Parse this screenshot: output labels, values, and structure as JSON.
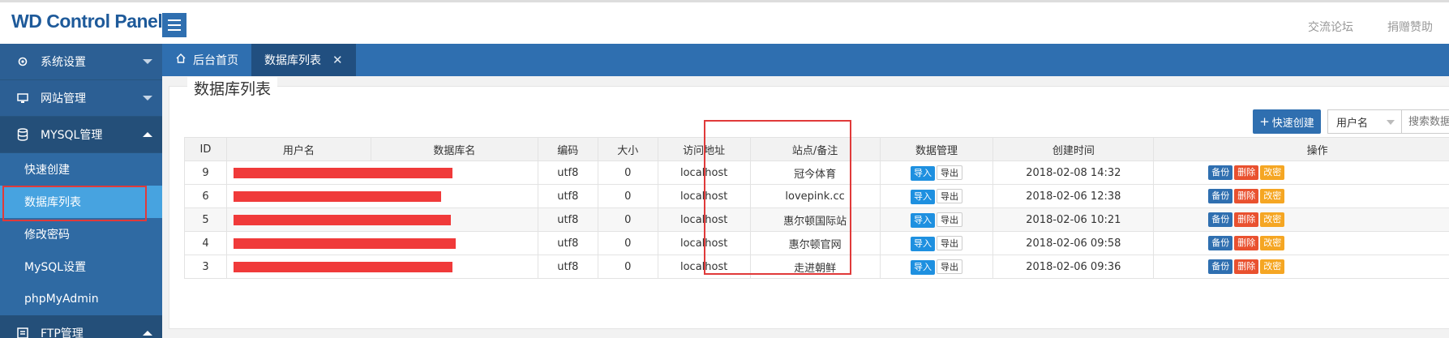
{
  "brand": "WD Control Panel",
  "top_links": [
    "交流论坛",
    "捐赠赞助"
  ],
  "sidebar": {
    "groups": [
      {
        "label": "系统设置",
        "icon": "gear-icon"
      },
      {
        "label": "网站管理",
        "icon": "monitor-icon"
      },
      {
        "label": "MYSQL管理",
        "icon": "database-icon"
      }
    ],
    "subitems": [
      "快速创建",
      "数据库列表",
      "修改密码",
      "MySQL设置",
      "phpMyAdmin"
    ],
    "last_group": {
      "label": "FTP管理",
      "icon": "ftp-icon"
    }
  },
  "tabs": [
    {
      "label": "后台首页",
      "icon": "home-icon"
    },
    {
      "label": "数据库列表"
    }
  ],
  "panel_title": "数据库列表",
  "toolbar": {
    "quick_create": "快速创建",
    "select_value": "用户名",
    "search_placeholder": "搜索数据"
  },
  "table": {
    "headers": [
      "ID",
      "用户名",
      "数据库名",
      "编码",
      "大小",
      "访问地址",
      "站点/备注",
      "数据管理",
      "创建时间",
      "操作"
    ],
    "rows": [
      {
        "id": "9",
        "charset": "utf8",
        "size": "0",
        "host": "localhost",
        "note": "冠今体育",
        "created": "2018-02-08 14:32"
      },
      {
        "id": "6",
        "charset": "utf8",
        "size": "0",
        "host": "localhost",
        "note": "lovepink.cc",
        "created": "2018-02-06 12:38"
      },
      {
        "id": "5",
        "charset": "utf8",
        "size": "0",
        "host": "localhost",
        "note": "惠尔顿国际站",
        "created": "2018-02-06 10:21"
      },
      {
        "id": "4",
        "charset": "utf8",
        "size": "0",
        "host": "localhost",
        "note": "惠尔顿官网",
        "created": "2018-02-06 09:58"
      },
      {
        "id": "3",
        "charset": "utf8",
        "size": "0",
        "host": "localhost",
        "note": "走进朝鲜",
        "created": "2018-02-06 09:36"
      }
    ],
    "data_buttons": {
      "import": "导入",
      "export": "导出"
    },
    "action_buttons": {
      "backup": "备份",
      "delete": "删除",
      "password": "改密"
    }
  }
}
